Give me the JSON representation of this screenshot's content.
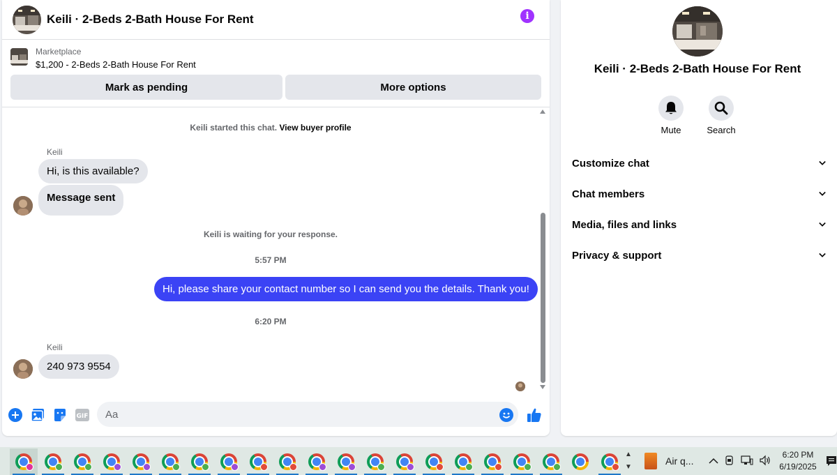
{
  "chat": {
    "title": "Keili · 2-Beds 2-Bath House For Rent",
    "listing": {
      "source": "Marketplace",
      "price_title": "$1,200 - 2-Beds 2-Bath House For Rent"
    },
    "buttons": {
      "mark_pending": "Mark as pending",
      "more_options": "More options"
    },
    "started_note": "Keili started this chat.",
    "view_profile": "View buyer profile",
    "messages": [
      {
        "sender": "Keili",
        "text": "Hi, is this available?"
      },
      {
        "text": "Message sent"
      }
    ],
    "waiting_note": "Keili is waiting for your response.",
    "time_1": "5:57 PM",
    "outgoing": "Hi, please share your contact number so I can send you the details. Thank you!",
    "time_2": "6:20 PM",
    "reply": {
      "sender": "Keili",
      "text": "240 973 9554"
    },
    "composer_placeholder": "Aa"
  },
  "info_panel": {
    "title": "Keili · 2-Beds 2-Bath House For Rent",
    "actions": [
      {
        "label": "Mute",
        "icon": "bell-icon"
      },
      {
        "label": "Search",
        "icon": "search-icon"
      }
    ],
    "sections": [
      "Customize chat",
      "Chat members",
      "Media, files and links",
      "Privacy & support"
    ]
  },
  "taskbar": {
    "widget_label": "Air q...",
    "time": "6:20 PM",
    "date": "6/19/2025",
    "profile_colors": [
      "#e0349a",
      "#4caf50",
      "#4caf50",
      "#9c4dd6",
      "#9c4dd6",
      "#4caf50",
      "#4caf50",
      "#9c4dd6",
      "#e04b3a",
      "#e04b3a",
      "#9c4dd6",
      "#9c4dd6",
      "#4caf50",
      "#9c4dd6",
      "#e04b3a",
      "#4caf50",
      "#e04b3a",
      "#4caf50",
      "#4caf50",
      "",
      "#e04b3a"
    ]
  },
  "colors": {
    "accent": "#3b43f5",
    "info": "#a033ff",
    "link_blue": "#1877f2"
  }
}
